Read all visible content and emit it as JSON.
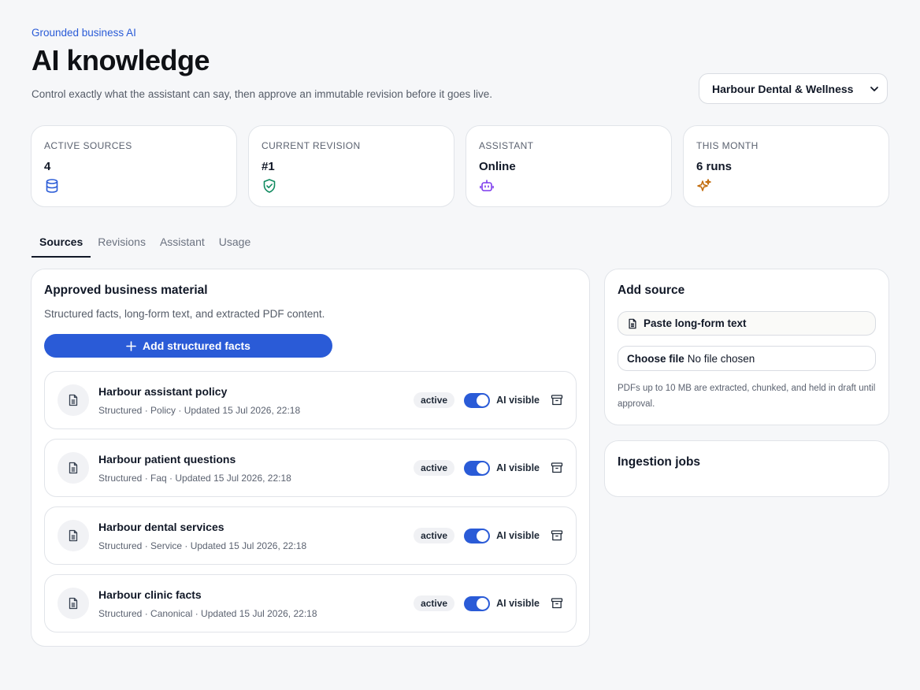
{
  "header": {
    "eyebrow": "Grounded business AI",
    "title": "AI knowledge",
    "description": "Control exactly what the assistant can say, then approve an immutable revision before it goes live.",
    "clinic_select": {
      "value": "Harbour Dental & Wellness"
    }
  },
  "stats": [
    {
      "label": "Active sources",
      "value": "4",
      "icon": "database-icon",
      "color": "#2a5bd7"
    },
    {
      "label": "Current revision",
      "value": "#1",
      "icon": "shield-check-icon",
      "color": "#0f8a5f"
    },
    {
      "label": "Assistant",
      "value": "Online",
      "icon": "bot-icon",
      "color": "#7c3aed"
    },
    {
      "label": "This month",
      "value": "6 runs",
      "icon": "sparkles-icon",
      "color": "#c26b0a"
    }
  ],
  "tabs": [
    {
      "label": "Sources",
      "active": true
    },
    {
      "label": "Revisions",
      "active": false
    },
    {
      "label": "Assistant",
      "active": false
    },
    {
      "label": "Usage",
      "active": false
    }
  ],
  "main": {
    "title": "Approved business material",
    "subtitle": "Structured facts, long-form text, and extracted PDF content.",
    "add_button": "Add structured facts",
    "sources": [
      {
        "name": "Harbour assistant policy",
        "meta": "Structured · Policy · Updated 15 Jul 2026, 22:18",
        "status": "active",
        "toggle_label": "AI visible",
        "ai_visible": true
      },
      {
        "name": "Harbour patient questions",
        "meta": "Structured · Faq · Updated 15 Jul 2026, 22:18",
        "status": "active",
        "toggle_label": "AI visible",
        "ai_visible": true
      },
      {
        "name": "Harbour dental services",
        "meta": "Structured · Service · Updated 15 Jul 2026, 22:18",
        "status": "active",
        "toggle_label": "AI visible",
        "ai_visible": true
      },
      {
        "name": "Harbour clinic facts",
        "meta": "Structured · Canonical · Updated 15 Jul 2026, 22:18",
        "status": "active",
        "toggle_label": "AI visible",
        "ai_visible": true
      }
    ]
  },
  "add_source": {
    "title": "Add source",
    "paste_button": "Paste long-form text",
    "file_button": "Choose file",
    "file_status": "No file chosen",
    "hint": "PDFs up to 10 MB are extracted, chunked, and held in draft until approval."
  },
  "ingestion": {
    "title": "Ingestion jobs"
  },
  "colors": {
    "accent": "#2a5bd7",
    "background": "#f6f7f9"
  }
}
